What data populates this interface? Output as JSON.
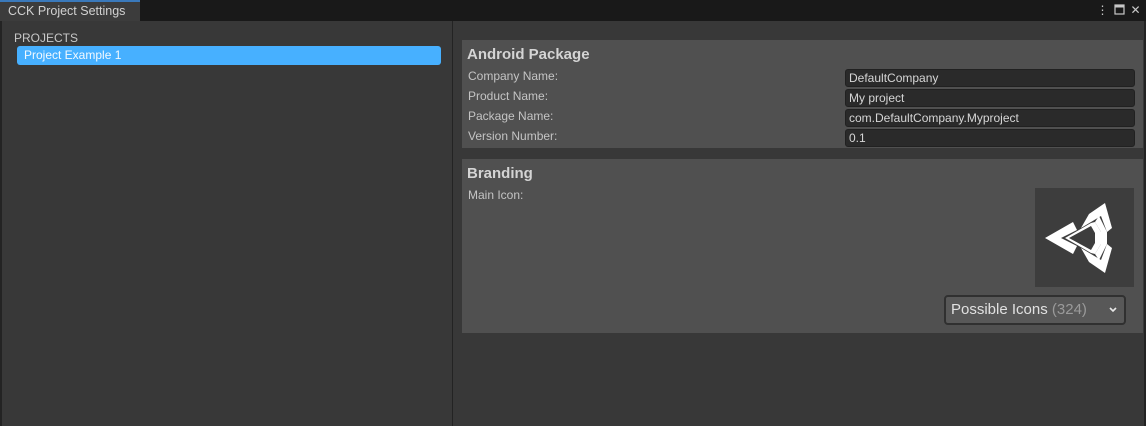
{
  "window": {
    "tab_title": "CCK Project Settings",
    "controls": [
      "⋮",
      "□",
      "✕"
    ]
  },
  "sidebar": {
    "header": "PROJECTS",
    "items": [
      {
        "label": "Project Example 1",
        "selected": true
      }
    ]
  },
  "android_package": {
    "title": "Android Package",
    "fields": [
      {
        "label": "Company Name:",
        "value": "DefaultCompany"
      },
      {
        "label": "Product Name:",
        "value": "My project"
      },
      {
        "label": "Package Name:",
        "value": "com.DefaultCompany.Myproject"
      },
      {
        "label": "Version Number:",
        "value": "0.1"
      }
    ]
  },
  "branding": {
    "title": "Branding",
    "main_icon_label": "Main Icon:",
    "icon_name": "unity-logo-icon",
    "possible_icons_label": "Possible Icons",
    "possible_icons_count": "(324)"
  },
  "colors": {
    "selection": "#47b0ff",
    "panel": "#383838",
    "section": "#505050"
  }
}
